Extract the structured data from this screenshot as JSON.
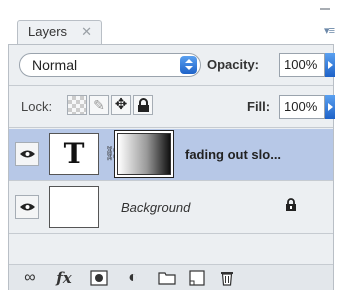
{
  "panel": {
    "tab_label": "Layers",
    "tab_close": "✕",
    "menu_glyph": "▾≡"
  },
  "blend": {
    "mode": "Normal",
    "opacity_label": "Opacity:",
    "opacity_value": "100%"
  },
  "lock": {
    "label": "Lock:",
    "fill_label": "Fill:",
    "fill_value": "100%"
  },
  "layers": [
    {
      "name": "fading out slo...",
      "thumb_glyph": "T",
      "chain_glyph": "⛓",
      "selected": true
    },
    {
      "name": "Background",
      "selected": false
    }
  ],
  "toolbar": {
    "link_glyph": "∞",
    "fx_label": "fx",
    "adjust_glyph": "◐"
  }
}
